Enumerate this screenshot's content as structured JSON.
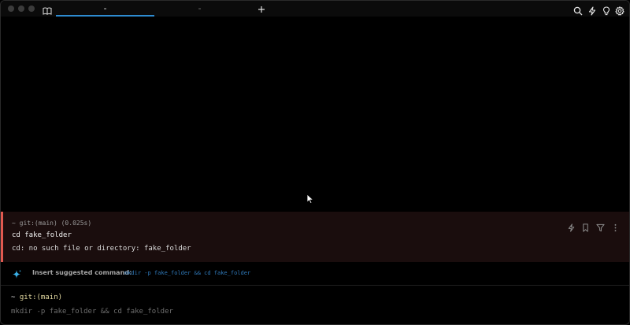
{
  "tabs": [
    {
      "label": "-"
    },
    {
      "label": "-"
    }
  ],
  "colors": {
    "active_tab_underline": "#2e8bd0",
    "error_border": "#e0594f",
    "error_background": "#1a0d0d",
    "suggestion_command": "#2f78b8",
    "git_branch": "#e2d8a0"
  },
  "toolbar_icons": [
    "search-icon",
    "bolt-icon",
    "lightbulb-icon",
    "gear-icon"
  ],
  "block": {
    "prompt": "~ git:(main) (0.025s)",
    "command": "cd fake_folder",
    "output": "cd: no such file or directory: fake_folder",
    "action_icons": [
      "bolt-icon",
      "bookmark-icon",
      "filter-icon",
      "more-icon"
    ]
  },
  "suggestion": {
    "label": "Insert suggested command:",
    "command": "mkdir -p fake_folder && cd fake_folder"
  },
  "input": {
    "prompt_dir": "~ ",
    "prompt_git": "git:(main)",
    "placeholder": "mkdir -p fake_folder && cd fake_folder"
  }
}
